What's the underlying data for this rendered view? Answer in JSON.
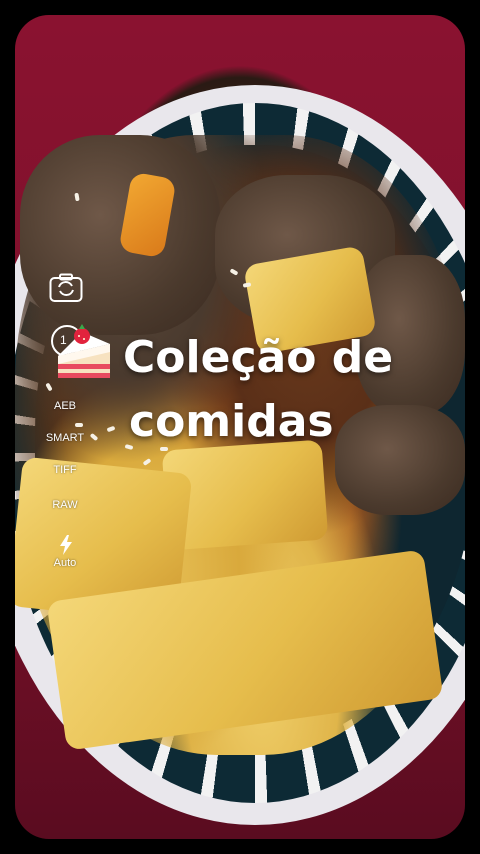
{
  "overlay": {
    "title_line1": "Coleção de",
    "title_line2": "comidas",
    "timer_value": "1"
  },
  "camera_modes": [
    {
      "label": "AEB"
    },
    {
      "label": "SMART"
    },
    {
      "label": "TIFF"
    },
    {
      "label": "RAW"
    }
  ],
  "flash": {
    "label": "Auto"
  },
  "icons": {
    "camera": "camera-switch-icon",
    "timer": "timer-icon",
    "cake": "cake-emoji-icon",
    "flash": "flash-icon"
  }
}
